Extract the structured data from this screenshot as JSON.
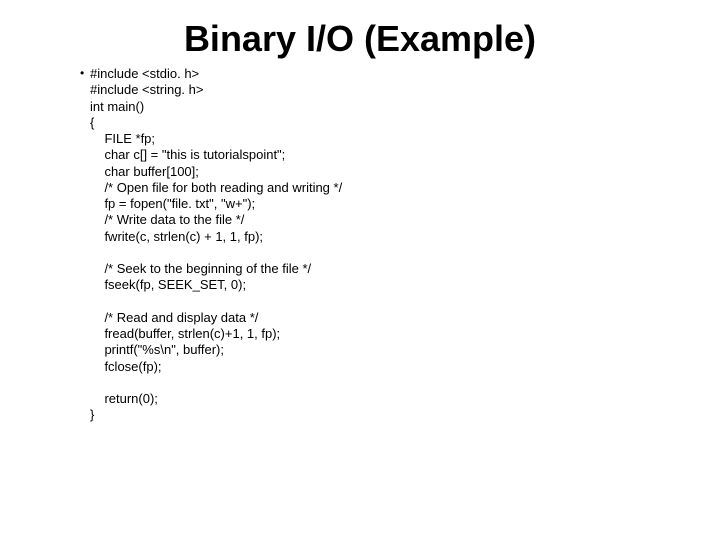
{
  "title": "Binary I/O (Example)",
  "bullet_glyph": "•",
  "code": "#include <stdio. h>\n#include <string. h>\nint main()\n{\n    FILE *fp;\n    char c[] = \"this is tutorialspoint\";\n    char buffer[100];\n    /* Open file for both reading and writing */\n    fp = fopen(\"file. txt\", \"w+\");\n    /* Write data to the file */\n    fwrite(c, strlen(c) + 1, 1, fp);\n\n    /* Seek to the beginning of the file */\n    fseek(fp, SEEK_SET, 0);\n\n    /* Read and display data */\n    fread(buffer, strlen(c)+1, 1, fp);\n    printf(\"%s\\n\", buffer);\n    fclose(fp);\n\n    return(0);\n}"
}
